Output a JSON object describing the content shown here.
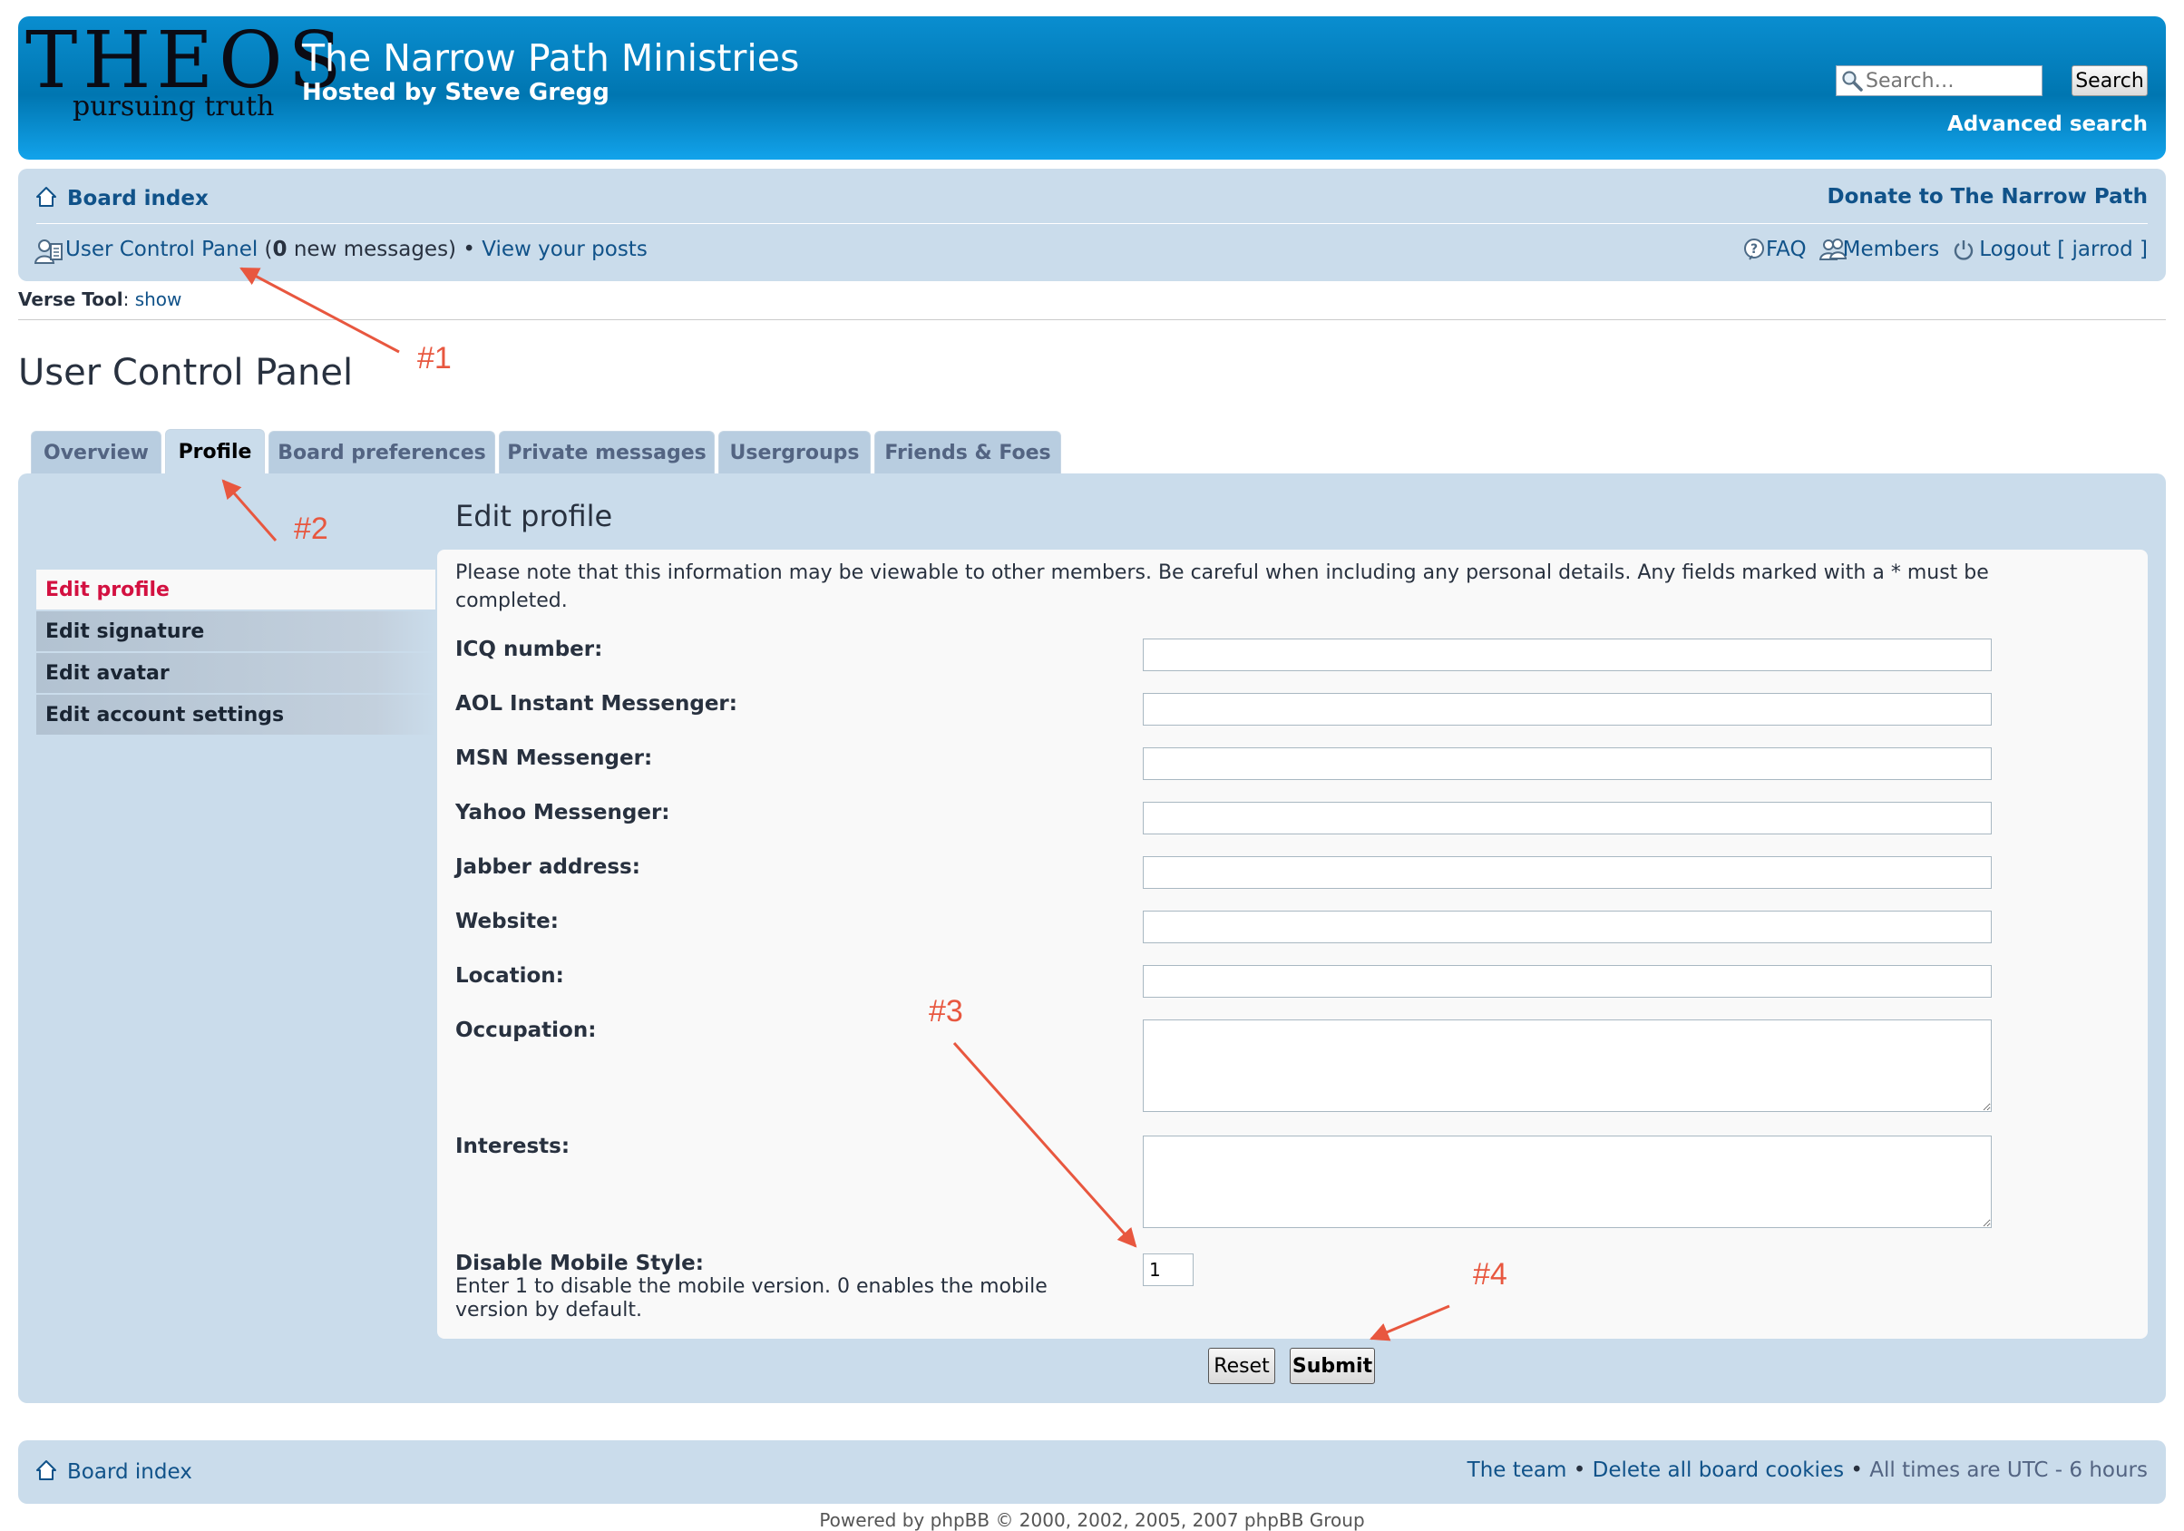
{
  "header": {
    "logo_word": "THEOS",
    "logo_tagline": "pursuing truth",
    "site_title": "The Narrow Path Ministries",
    "site_description": "Hosted by Steve Gregg",
    "search_placeholder": "Search…",
    "search_button": "Search",
    "advanced_search": "Advanced search"
  },
  "navbar": {
    "board_index": "Board index",
    "donate": "Donate to The Narrow Path",
    "ucp_link": "User Control Panel",
    "ucp_paren_open": " (",
    "new_count": "0",
    "new_messages_suffix": " new messages)",
    "bullet": " • ",
    "view_posts": "View your posts",
    "faq": "FAQ",
    "members": "Members",
    "logout": "Logout [ jarrod ]"
  },
  "verse_tool": {
    "label": "Verse Tool",
    "colon": ": ",
    "action": "show"
  },
  "page_title": "User Control Panel",
  "tabs": [
    {
      "label": "Overview"
    },
    {
      "label": "Profile"
    },
    {
      "label": "Board preferences"
    },
    {
      "label": "Private messages"
    },
    {
      "label": "Usergroups"
    },
    {
      "label": "Friends & Foes"
    }
  ],
  "side_menu": [
    {
      "label": "Edit profile"
    },
    {
      "label": "Edit signature"
    },
    {
      "label": "Edit avatar"
    },
    {
      "label": "Edit account settings"
    }
  ],
  "content": {
    "title": "Edit profile",
    "note": "Please note that this information may be viewable to other members. Be careful when including any personal details. Any fields marked with a * must be completed.",
    "fields": [
      {
        "label": "ICQ number:",
        "value": ""
      },
      {
        "label": "AOL Instant Messenger:",
        "value": ""
      },
      {
        "label": "MSN Messenger:",
        "value": ""
      },
      {
        "label": "Yahoo Messenger:",
        "value": ""
      },
      {
        "label": "Jabber address:",
        "value": ""
      },
      {
        "label": "Website:",
        "value": ""
      },
      {
        "label": "Location:",
        "value": ""
      },
      {
        "label": "Occupation:",
        "value": ""
      },
      {
        "label": "Interests:",
        "value": ""
      }
    ],
    "mobile": {
      "label": "Disable Mobile Style:",
      "description": "Enter 1 to disable the mobile version. 0 enables the mobile version by default.",
      "value": "1"
    },
    "reset_button": "Reset",
    "submit_button": "Submit"
  },
  "annotations": [
    "#1",
    "#2",
    "#3",
    "#4"
  ],
  "footer": {
    "board_index": "Board index",
    "the_team": "The team",
    "bullet": " • ",
    "delete_cookies": "Delete all board cookies",
    "timezone": "All times are UTC - 6 hours"
  },
  "copyright": "Powered by phpBB © 2000, 2002, 2005, 2007 phpBB Group",
  "colors": {
    "header_blue": "#0076b1",
    "panel_blue": "#cadceb",
    "link_blue": "#105289",
    "active_red": "#d31141",
    "annotation_red": "#e8573f"
  }
}
